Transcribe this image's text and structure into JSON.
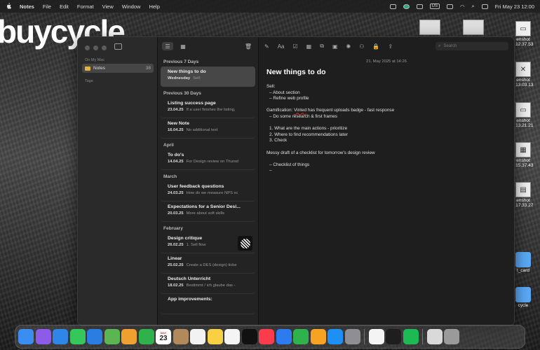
{
  "menubar": {
    "app": "Notes",
    "items": [
      "File",
      "Edit",
      "Format",
      "View",
      "Window",
      "Help"
    ],
    "input_source": "US",
    "datetime": "Fri May 23  12:00"
  },
  "desktop": {
    "brand_text": "buycycle",
    "icons": [
      {
        "label": "enshot\nt 12.37.53"
      },
      {
        "label": "enshot\nt 13.03.13"
      },
      {
        "label": "enshot\nt 13.21.21"
      },
      {
        "label": "enshot\nt 15.37.43"
      },
      {
        "label": "enshot\nt 17.33.27"
      },
      {
        "label": "t_card"
      },
      {
        "label": "cycle"
      }
    ]
  },
  "sidebar": {
    "section": "On My Mac",
    "folder": {
      "name": "Notes",
      "count": "38"
    },
    "tags": "Tags"
  },
  "list": {
    "groups": [
      {
        "title": "Previous 7 Days",
        "notes": [
          {
            "title": "New things to do",
            "date": "Wednesday",
            "preview": "Sell:",
            "selected": true
          }
        ]
      },
      {
        "title": "Previous 30 Days",
        "notes": [
          {
            "title": "Listing success page",
            "date": "23.04.25",
            "preview": "If a user finishes the listing,"
          },
          {
            "title": "New Note",
            "date": "16.04.25",
            "preview": "No additional text"
          }
        ]
      },
      {
        "title": "April",
        "notes": [
          {
            "title": "To do's",
            "date": "14.04.25",
            "preview": "For Design review on Thursd"
          }
        ]
      },
      {
        "title": "March",
        "notes": [
          {
            "title": "User feedback questions",
            "date": "24.03.25",
            "preview": "How do we measure NPS sc"
          },
          {
            "title": "Expectations for a Senior Desi...",
            "date": "20.03.25",
            "preview": "More about soft skills"
          }
        ]
      },
      {
        "title": "February",
        "notes": [
          {
            "title": "Design critique",
            "date": "26.02.25",
            "preview": "1. Sell flow",
            "thumb": true
          },
          {
            "title": "Linear",
            "date": "25.02.25",
            "preview": "Create a DES (design) ticke"
          },
          {
            "title": "Deutsch Unterricht",
            "date": "18.02.25",
            "preview": "Bestimmt / ich glaube das -"
          },
          {
            "title": "App improvements:",
            "date": "",
            "preview": ""
          }
        ]
      }
    ]
  },
  "editor": {
    "search_placeholder": "Search",
    "date": "21. May 2025 at 14:26",
    "title": "New things to do",
    "lines": {
      "l1": "Sell:",
      "l2": "–  About section",
      "l3": "–  Refine web profile",
      "l4a": "Gamification: ",
      "l4b": "Vinted",
      "l4c": " has frequent uploads badge - fast response",
      "l5": "–  Do some research & first frames",
      "l6": "1.  What are the main actions - prioritize",
      "l7": "2.  Where to find recommendations later",
      "l8": "3.  Check",
      "l9": "Messy draft of a checklist for tomorrow's design review",
      "l10": "–  Checklist of things",
      "l11": "–"
    }
  },
  "dock": {
    "calendar_month": "MAY",
    "calendar_day": "23",
    "apps": [
      {
        "name": "finder",
        "color": "#3b8df0"
      },
      {
        "name": "launchpad",
        "color": "#8c5be8"
      },
      {
        "name": "safari",
        "color": "#2f86e8"
      },
      {
        "name": "messages",
        "color": "#35c759"
      },
      {
        "name": "mail",
        "color": "#2a7de1"
      },
      {
        "name": "maps",
        "color": "#5ab552"
      },
      {
        "name": "photos",
        "color": "#f0a030"
      },
      {
        "name": "facetime",
        "color": "#2fb24c"
      },
      {
        "name": "calendar",
        "color": "#ffffff"
      },
      {
        "name": "contacts",
        "color": "#b08a5a"
      },
      {
        "name": "reminders",
        "color": "#f2f2f2"
      },
      {
        "name": "notes",
        "color": "#f7d046"
      },
      {
        "name": "freeform",
        "color": "#f4f4f4"
      },
      {
        "name": "tv",
        "color": "#111111"
      },
      {
        "name": "music",
        "color": "#fa3c4c"
      },
      {
        "name": "keynote",
        "color": "#2e7bf0"
      },
      {
        "name": "numbers",
        "color": "#2fb24c"
      },
      {
        "name": "pages",
        "color": "#f6a324"
      },
      {
        "name": "app-store",
        "color": "#1e90f5"
      },
      {
        "name": "system-settings",
        "color": "#8e8e93"
      },
      {
        "name": "chrome",
        "color": "#f4f4f4"
      },
      {
        "name": "figma",
        "color": "#1e1e1e"
      },
      {
        "name": "spotify",
        "color": "#1db954"
      },
      {
        "name": "downloads",
        "color": "#d9d9d9"
      },
      {
        "name": "trash",
        "color": "#9a9a9a"
      }
    ]
  }
}
